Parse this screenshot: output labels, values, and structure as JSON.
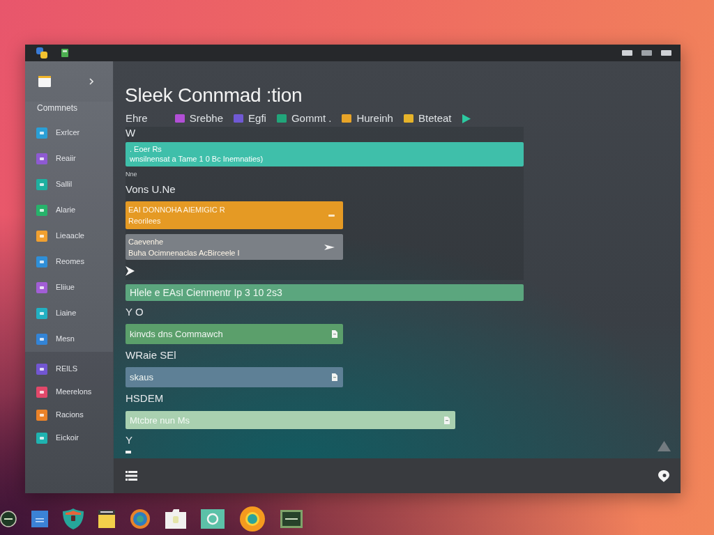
{
  "sidebar": {
    "sections": [
      {
        "heading": "Commnets",
        "items": [
          {
            "label": "Exrlcer",
            "color": "#2a9fd6"
          },
          {
            "label": "Reaiir",
            "color": "#8e5ad2"
          },
          {
            "label": "Sallil",
            "color": "#1fb0a0"
          },
          {
            "label": "Alarie",
            "color": "#27b36b"
          },
          {
            "label": "Lieaacle",
            "color": "#f0a030"
          },
          {
            "label": "Reomes",
            "color": "#2f8fd8"
          },
          {
            "label": "Eliiue",
            "color": "#a25ed6"
          },
          {
            "label": "Liaine",
            "color": "#22b0c2"
          },
          {
            "label": "Mesn",
            "color": "#3384d6"
          }
        ]
      },
      {
        "items": [
          {
            "label": "RElLS",
            "color": "#7256d2"
          },
          {
            "label": "Meerelons",
            "color": "#e2486a"
          },
          {
            "label": "Racions",
            "color": "#ea8228"
          },
          {
            "label": "Eickoir",
            "color": "#1fb3b0"
          }
        ]
      }
    ]
  },
  "main": {
    "title": "Sleek Connmad :tion",
    "toolbar": [
      {
        "label": "Ehre"
      },
      {
        "label": "Srebhe",
        "color": "#b24fd6"
      },
      {
        "label": "Egfi",
        "color": "#7059d4"
      },
      {
        "label": "Gommt .",
        "color": "#21a57a"
      },
      {
        "label": "Hureinh",
        "color": "#e8a428"
      },
      {
        "label": "Bteteat",
        "color": "#e6b32a"
      }
    ],
    "panel": [
      {
        "kind": "label",
        "text": "W"
      },
      {
        "kind": "banner",
        "color": "#3fbfaa",
        "lines": [
          ". Eoer Rs",
          "wnsilnensat a Tame 1 0 Bc Inemnaties)"
        ]
      },
      {
        "kind": "caption",
        "text": "Nne"
      },
      {
        "kind": "label",
        "text": "Vons U.Ne"
      },
      {
        "kind": "card",
        "color": "#e59a24",
        "lines": [
          "EAI DONNOHA AlEMIGIC R",
          "Reorilees"
        ]
      },
      {
        "kind": "nav-card",
        "color": "#7b8086",
        "lines": [
          "Caevenhe",
          "Buha Ocimnenaclas AcBirceele I"
        ]
      },
      {
        "kind": "chevron"
      }
    ],
    "form": [
      {
        "kind": "strip",
        "color": "#5ba67e",
        "text": "Hlele e EAsI Cienmentr Ip 3 10 2s3"
      },
      {
        "kind": "label",
        "text": "Y O"
      },
      {
        "kind": "field",
        "color": "#5b9f6b",
        "value": "kinvds dns Commawch"
      },
      {
        "kind": "label",
        "text": "WRaie SEl"
      },
      {
        "kind": "field",
        "color": "#5e8096",
        "value": "skaus"
      },
      {
        "kind": "label",
        "text": "HSDEM"
      },
      {
        "kind": "long-field",
        "color": "#a9d0b0",
        "placeholder": "Mtcbre nun Ms"
      },
      {
        "kind": "label",
        "text": "Y"
      },
      {
        "kind": "dash"
      }
    ]
  }
}
